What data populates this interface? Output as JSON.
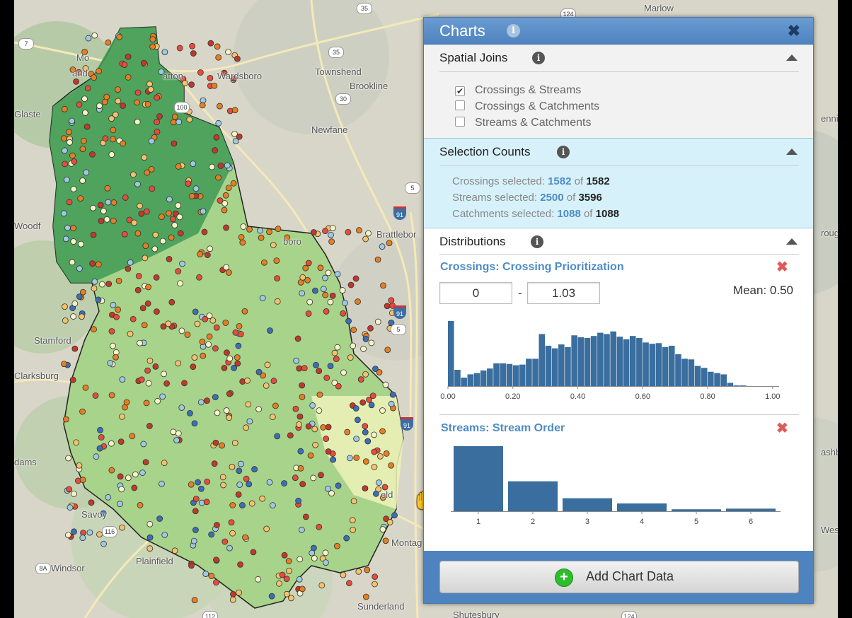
{
  "map": {
    "labels": [
      "Marlow",
      "Wardsboro",
      "Townshend",
      "Brookline",
      "Newfane",
      "Glaste",
      "Mo",
      "and",
      "atton",
      "Woodf",
      "Stamford",
      "Clarksburg",
      "dams",
      "Savoy",
      "Windsor",
      "Plainfield",
      "Sunderland",
      "Montag",
      "eld",
      "Brattlebor",
      "boro",
      "rough",
      "Westm",
      "ashbu",
      "enning",
      "Shutesbury"
    ],
    "shields": [
      "35",
      "35",
      "30",
      "100",
      "7",
      "5",
      "5",
      "8A",
      "116",
      "112",
      "91",
      "91",
      "91",
      "124",
      "124"
    ]
  },
  "panel": {
    "title": "Charts",
    "close_glyph": "✖",
    "info_glyph": "i"
  },
  "spatial_joins": {
    "title": "Spatial Joins",
    "options": [
      {
        "label": "Crossings & Streams",
        "checked": true
      },
      {
        "label": "Crossings & Catchments",
        "checked": false
      },
      {
        "label": "Streams & Catchments",
        "checked": false
      }
    ]
  },
  "selection_counts": {
    "title": "Selection Counts",
    "rows": [
      {
        "label": "Crossings selected:",
        "selected": "1582",
        "of": "of",
        "total": "1582"
      },
      {
        "label": "Streams selected:",
        "selected": "2500",
        "of": "of",
        "total": "3596"
      },
      {
        "label": "Catchments selected:",
        "selected": "1088",
        "of": "of",
        "total": "1088"
      }
    ]
  },
  "distributions": {
    "title": "Distributions",
    "remove_glyph": "✖",
    "crossing_chart": {
      "title": "Crossings: Crossing Prioritization",
      "range_min": "0",
      "range_dash": "-",
      "range_max": "1.03",
      "mean_label": "Mean:",
      "mean_value": "0.50"
    },
    "stream_chart": {
      "title": "Streams: Stream Order"
    }
  },
  "chart_data": [
    {
      "type": "bar",
      "title": "Crossings: Crossing Prioritization",
      "bar_color": "#3a6e9e",
      "bin_width": 0.02,
      "bin_starts": [
        0.0,
        0.02,
        0.04,
        0.06,
        0.08,
        0.1,
        0.12,
        0.14,
        0.16,
        0.18,
        0.2,
        0.22,
        0.24,
        0.26,
        0.28,
        0.3,
        0.32,
        0.34,
        0.36,
        0.38,
        0.4,
        0.42,
        0.44,
        0.46,
        0.48,
        0.5,
        0.52,
        0.54,
        0.56,
        0.58,
        0.6,
        0.62,
        0.64,
        0.66,
        0.68,
        0.7,
        0.72,
        0.74,
        0.76,
        0.78,
        0.8,
        0.82,
        0.84,
        0.86,
        0.88,
        0.9,
        0.92,
        0.94,
        0.96,
        0.98,
        1.0
      ],
      "values": [
        100,
        25,
        13,
        18,
        20,
        24,
        27,
        35,
        35,
        34,
        32,
        33,
        42,
        42,
        80,
        62,
        58,
        64,
        60,
        78,
        75,
        74,
        77,
        82,
        80,
        84,
        76,
        72,
        77,
        74,
        67,
        65,
        66,
        60,
        62,
        49,
        42,
        41,
        31,
        28,
        22,
        20,
        18,
        5,
        1,
        1,
        0,
        0,
        0,
        0,
        0
      ],
      "ticks": [
        "0.00",
        "0.20",
        "0.40",
        "0.60",
        "0.80",
        "1.00"
      ],
      "xlim": [
        0,
        1.02
      ]
    },
    {
      "type": "bar",
      "title": "Streams: Stream Order",
      "bar_color": "#3a6e9e",
      "categories": [
        "1",
        "2",
        "3",
        "4",
        "5",
        "6"
      ],
      "values": [
        100,
        46,
        20,
        12,
        3,
        4
      ]
    }
  ],
  "footer": {
    "add_label": "Add Chart Data",
    "add_glyph": "+"
  },
  "colors": {
    "header": "#5a8fc9",
    "accent": "#4f8cc6",
    "remove": "#e05a5a",
    "selection_bg": "#d7f1fb"
  }
}
